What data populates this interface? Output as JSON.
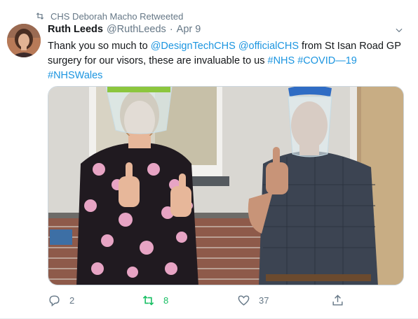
{
  "retweet_context": {
    "text": "CHS Deborah Macho Retweeted",
    "icon": "retweet-icon"
  },
  "author": {
    "name": "Ruth Leeds",
    "handle": "@RuthLeeds",
    "separator": "·",
    "date": "Apr 9"
  },
  "tweet": {
    "before": "Thank you so much to ",
    "mention1": "@DesignTechCHS",
    "space1": " ",
    "mention2": "@officialCHS",
    "middle": " from St Isan Road GP surgery for our visors, these are invaluable to us ",
    "hashtag1": "#NHS",
    "space2": " ",
    "hashtag2": "#COVID—19",
    "space3": " ",
    "hashtag3": "#NHSWales"
  },
  "actions": {
    "reply_count": "2",
    "retweet_count": "8",
    "like_count": "37"
  },
  "colors": {
    "link": "#1b95e0",
    "muted": "#657786",
    "retweet_active": "#17bf63"
  }
}
